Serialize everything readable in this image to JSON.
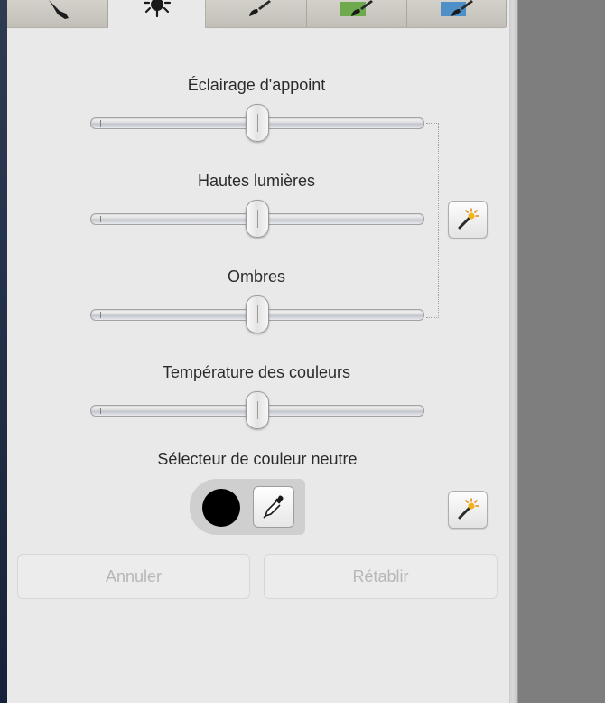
{
  "tabs": [
    {
      "icon": "wrench-icon",
      "active": false
    },
    {
      "icon": "sun-icon",
      "active": true
    },
    {
      "icon": "brush-icon",
      "active": false
    },
    {
      "icon": "brush-green-icon",
      "active": false
    },
    {
      "icon": "brush-blue-icon",
      "active": false
    }
  ],
  "sliders": [
    {
      "label": "Éclairage d'appoint",
      "value": 0.5
    },
    {
      "label": "Hautes lumières",
      "value": 0.5
    },
    {
      "label": "Ombres",
      "value": 0.5
    },
    {
      "label": "Température des couleurs",
      "value": 0.5
    }
  ],
  "neutral_picker": {
    "label": "Sélecteur de couleur neutre",
    "swatch_color": "#000000"
  },
  "buttons": {
    "cancel": "Annuler",
    "redo": "Rétablir"
  },
  "icons": {
    "auto_levels": "magic-wand-icon",
    "auto_neutral": "magic-wand-icon",
    "eyedropper": "eyedropper-icon"
  }
}
